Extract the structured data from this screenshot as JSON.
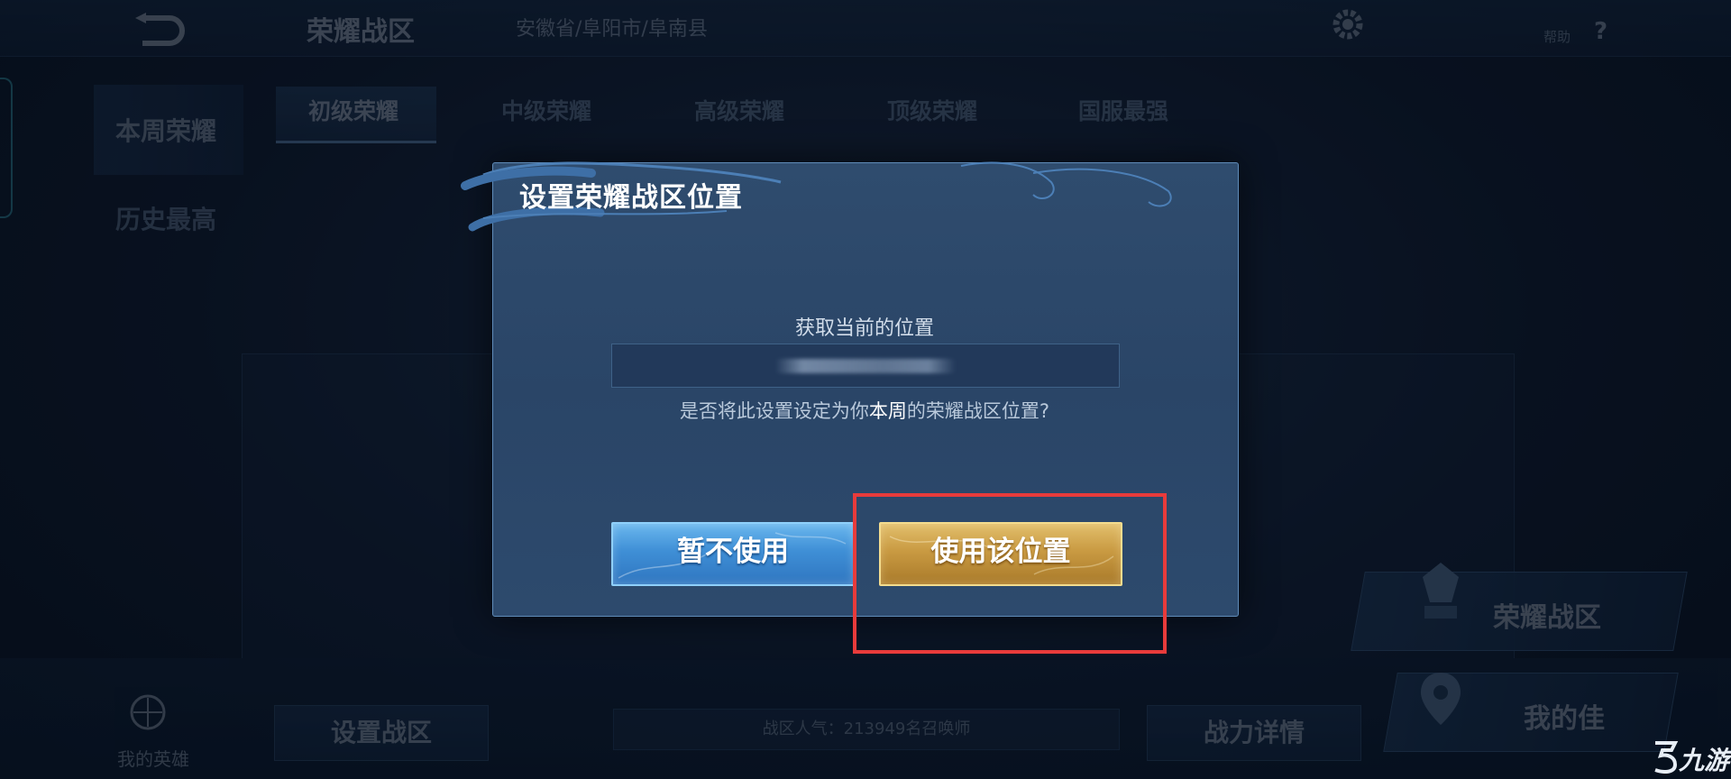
{
  "app": {
    "title": "荣耀战区",
    "subtitle": "",
    "location": "安徽省/阜阳市/阜南县",
    "help_label": "帮助",
    "help_icon": "?"
  },
  "tabs": [
    {
      "label": "初级荣耀",
      "active": true
    },
    {
      "label": "中级荣耀",
      "active": false
    },
    {
      "label": "高级荣耀",
      "active": false
    },
    {
      "label": "顶级荣耀",
      "active": false
    },
    {
      "label": "国服最强",
      "active": false
    }
  ],
  "sidebar": {
    "items": [
      {
        "label": "本周荣耀",
        "active": true
      },
      {
        "label": "历史最高",
        "active": false
      }
    ]
  },
  "bottom": {
    "my_hero_label": "我的英雄",
    "set_zone_button": "设置战区",
    "zone_popularity": "战区人气：213949名召唤师",
    "power_detail_button": "战力详情",
    "glory_zone_card": "荣耀战区",
    "my_card": "我的佳"
  },
  "dialog": {
    "title": "设置荣耀战区位置",
    "fetch_label": "获取当前的位置",
    "question_prefix": "是否将此设置设定为你",
    "question_highlight": "本周",
    "question_suffix": "的荣耀战区位置?",
    "cancel_button": "暂不使用",
    "confirm_button": "使用该位置"
  },
  "watermark": {
    "text": "九游"
  },
  "colors": {
    "highlight_box": "#e83b3b",
    "cancel_button": "#3f8fd6",
    "confirm_button": "#c99a42",
    "dialog_bg": "#2f4c6e"
  }
}
